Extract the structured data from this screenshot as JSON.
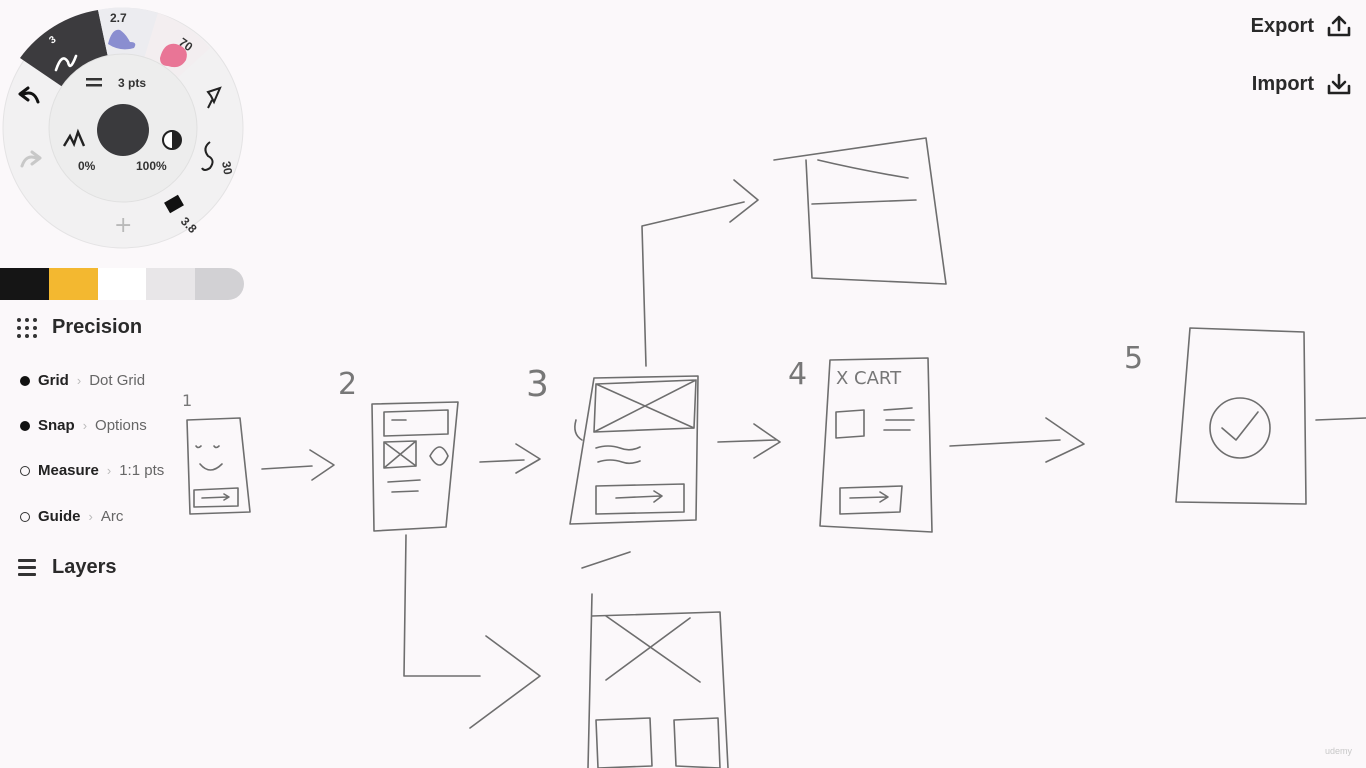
{
  "wheel": {
    "brush_size": "3",
    "preset_2": "2.7",
    "preset_3": "70",
    "preset_right_1": "30",
    "preset_right_2": "3.8",
    "thickness": "3 pts",
    "opacity_min": "0%",
    "opacity_max": "100%",
    "add": "+"
  },
  "palette": [
    "#151515",
    "#f3b830",
    "#ffffff",
    "#e8e6e8",
    "#d2d1d4"
  ],
  "precision": {
    "title": "Precision",
    "rows": [
      {
        "name": "Grid",
        "value": "Dot Grid",
        "active": true
      },
      {
        "name": "Snap",
        "value": "Options",
        "active": true
      },
      {
        "name": "Measure",
        "value": "1:1 pts",
        "active": false
      },
      {
        "name": "Guide",
        "value": "Arc",
        "active": false
      }
    ]
  },
  "layers": {
    "title": "Layers"
  },
  "top": {
    "export": "Export",
    "import": "Import"
  },
  "sketch": {
    "labels": [
      "1",
      "2",
      "3",
      "4",
      "5"
    ],
    "cart_text": "X CART"
  },
  "watermark": "udemy"
}
